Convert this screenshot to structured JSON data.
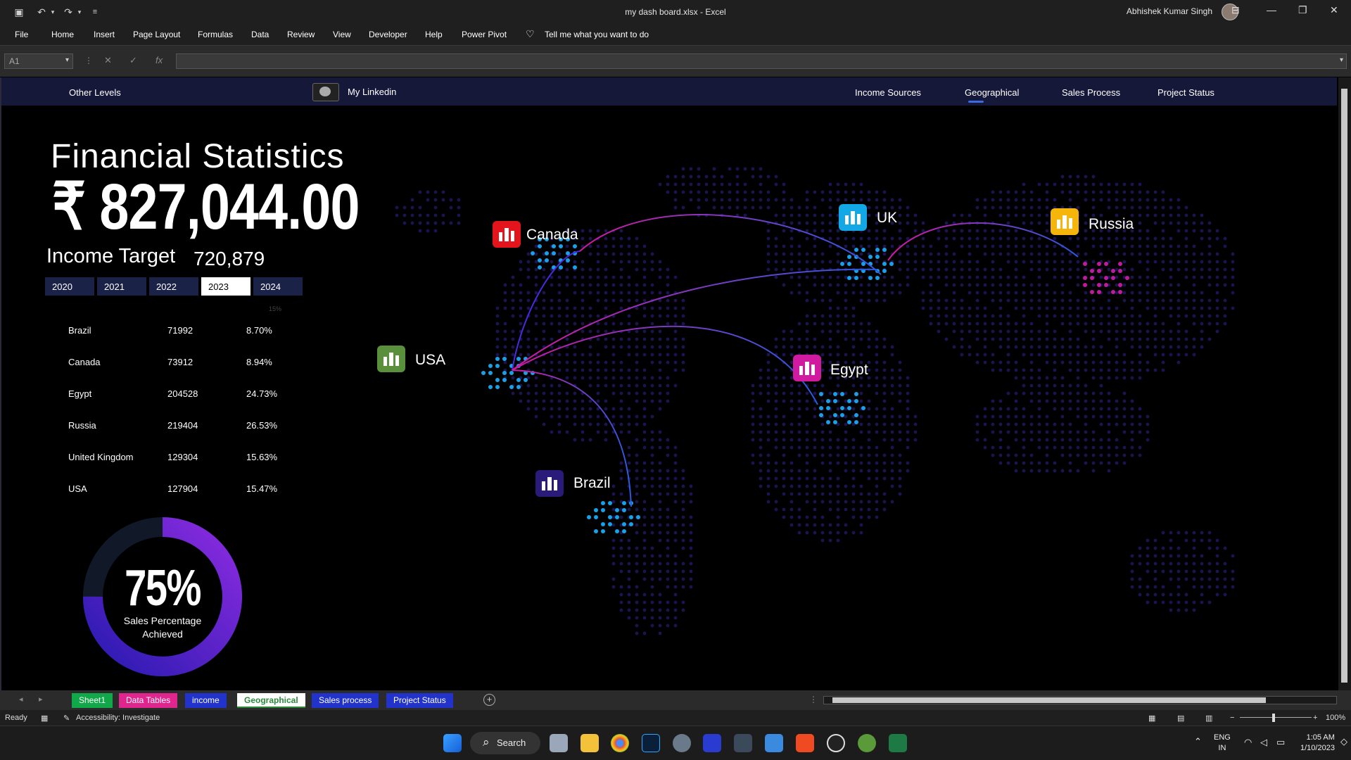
{
  "window": {
    "title": "my dash board.xlsx  -  Excel",
    "user": "Abhishek Kumar Singh"
  },
  "menu": [
    "File",
    "Home",
    "Insert",
    "Page Layout",
    "Formulas",
    "Data",
    "Review",
    "View",
    "Developer",
    "Help",
    "Power Pivot",
    "Tell me what you want to do"
  ],
  "formula_bar": {
    "name_box": "A1",
    "formula": ""
  },
  "nav": {
    "other_levels": "Other Levels",
    "linkedin": "My Linkedin",
    "income_sources": "Income Sources",
    "geographical": "Geographical",
    "sales_process": "Sales Process",
    "project_status": "Project Status"
  },
  "stats": {
    "title": "Financial Statistics",
    "amount": "₹ 827,044.00",
    "income_target_label": "Income Target",
    "income_target_value": "720,879",
    "years": [
      "2020",
      "2021",
      "2022",
      "2023",
      "2024"
    ],
    "selected_year": "2023",
    "faint_pct": "15%"
  },
  "countries": [
    {
      "name": "Brazil",
      "value": "71992",
      "pct": "8.70%"
    },
    {
      "name": "Canada",
      "value": "73912",
      "pct": "8.94%"
    },
    {
      "name": "Egypt",
      "value": "204528",
      "pct": "24.73%"
    },
    {
      "name": "Russia",
      "value": "219404",
      "pct": "26.53%"
    },
    {
      "name": "United Kingdom",
      "value": "129304",
      "pct": "15.63%"
    },
    {
      "name": "USA",
      "value": "127904",
      "pct": "15.47%"
    }
  ],
  "donut": {
    "value": "75%",
    "fraction": 0.75,
    "label_line1": "Sales Percentage",
    "label_line2": "Achieved"
  },
  "map_labels": {
    "canada": "Canada",
    "uk": "UK",
    "russia": "Russia",
    "usa": "USA",
    "egypt": "Egypt",
    "brazil": "Brazil"
  },
  "colors": {
    "canada": "#e3141b",
    "uk": "#12a8e6",
    "russia": "#f5b50a",
    "usa": "#5a8f3c",
    "egypt": "#d01aa0",
    "brazil": "#2a1a7a",
    "donut_start": "#3a1ab0",
    "donut_end": "#8a2be0",
    "navbar": "#16183a"
  },
  "sheet_tabs": [
    {
      "label": "Sheet1",
      "color": "#11a84a"
    },
    {
      "label": "Data Tables",
      "color": "#e0258f"
    },
    {
      "label": "income",
      "color": "#2233cc"
    },
    {
      "label": "Geographical",
      "color": "#ffffff"
    },
    {
      "label": "Sales process",
      "color": "#2233cc"
    },
    {
      "label": "Project Status",
      "color": "#2233cc"
    }
  ],
  "status": {
    "ready": "Ready",
    "accessibility": "Accessibility: Investigate",
    "zoom": "100%"
  },
  "taskbar": {
    "search": "Search",
    "lang1": "ENG",
    "lang2": "IN",
    "time": "1:05 AM",
    "date": "1/10/2023"
  }
}
